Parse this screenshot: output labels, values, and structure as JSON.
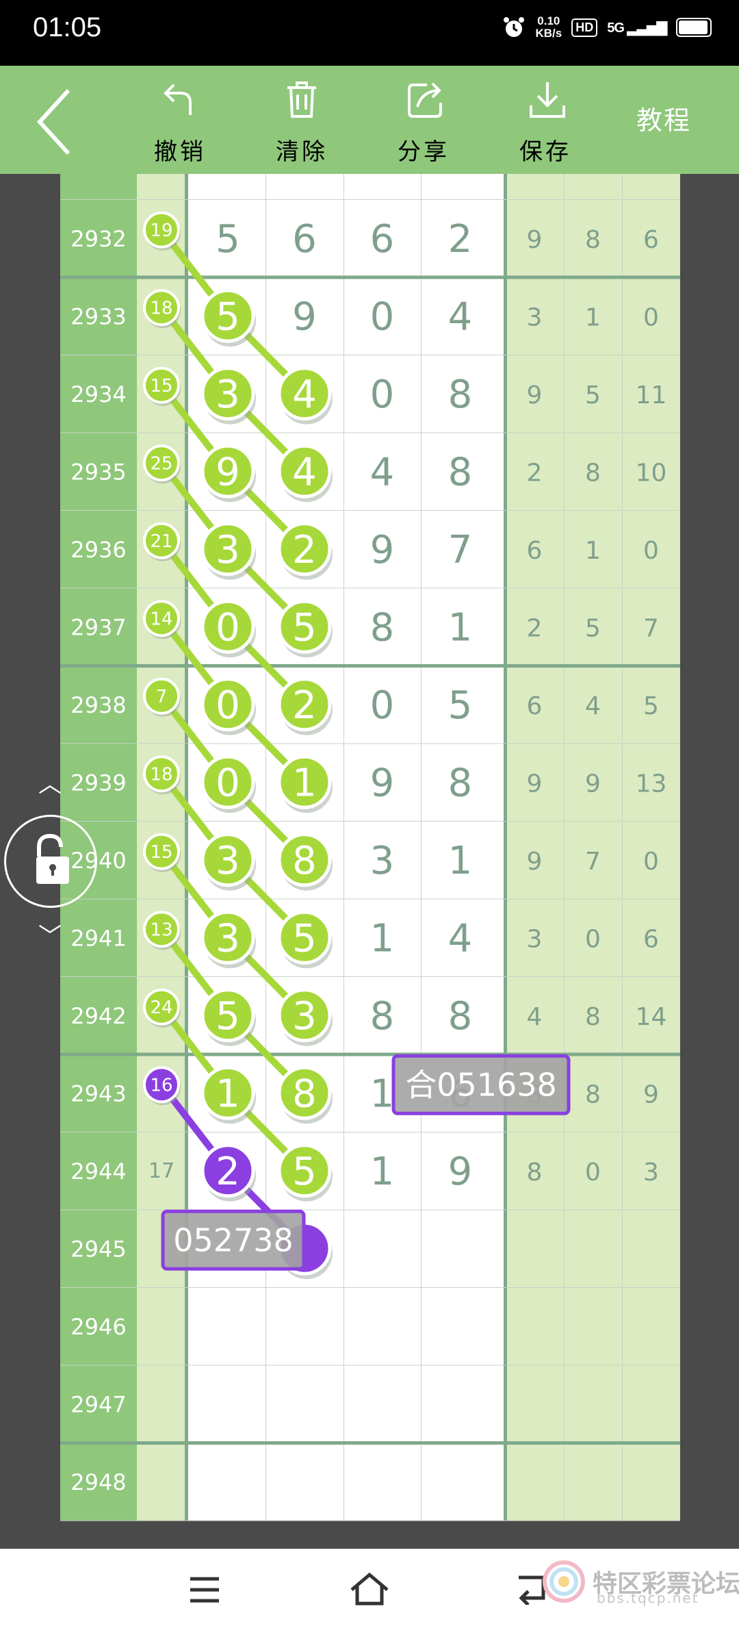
{
  "status": {
    "time": "01:05",
    "speed_value": "0.10",
    "speed_unit": "KB/s",
    "hd": "HD",
    "network": "5G"
  },
  "toolbar": {
    "undo": "撤销",
    "clear": "清除",
    "share": "分享",
    "save": "保存",
    "tutorial": "教程"
  },
  "watermark": {
    "name": "特区彩票论坛",
    "url": "bbs.tqcp.net"
  },
  "colors": {
    "toolbar": "#8fc77b",
    "highlight_green": "#a6d83a",
    "highlight_purple": "#8b3fe0",
    "digit_text": "#7f9f8c",
    "tag_bg": "#a3a3a3"
  },
  "chart_data": {
    "type": "table",
    "rows": [
      {
        "issue": "2932",
        "sum": "19",
        "digits": [
          "5",
          "6",
          "6",
          "2"
        ],
        "stats": [
          "9",
          "8",
          "6"
        ]
      },
      {
        "issue": "2933",
        "sum": "18",
        "digits": [
          "5",
          "9",
          "0",
          "4"
        ],
        "stats": [
          "3",
          "1",
          "0"
        ]
      },
      {
        "issue": "2934",
        "sum": "15",
        "digits": [
          "3",
          "4",
          "0",
          "8"
        ],
        "stats": [
          "9",
          "5",
          "11"
        ]
      },
      {
        "issue": "2935",
        "sum": "25",
        "digits": [
          "9",
          "4",
          "4",
          "8"
        ],
        "stats": [
          "2",
          "8",
          "10"
        ]
      },
      {
        "issue": "2936",
        "sum": "21",
        "digits": [
          "3",
          "2",
          "9",
          "7"
        ],
        "stats": [
          "6",
          "1",
          "0"
        ]
      },
      {
        "issue": "2937",
        "sum": "14",
        "digits": [
          "0",
          "5",
          "8",
          "1"
        ],
        "stats": [
          "2",
          "5",
          "7"
        ]
      },
      {
        "issue": "2938",
        "sum": "7",
        "digits": [
          "0",
          "2",
          "0",
          "5"
        ],
        "stats": [
          "6",
          "4",
          "5"
        ]
      },
      {
        "issue": "2939",
        "sum": "18",
        "digits": [
          "0",
          "1",
          "9",
          "8"
        ],
        "stats": [
          "9",
          "9",
          "13"
        ]
      },
      {
        "issue": "2940",
        "sum": "15",
        "digits": [
          "3",
          "8",
          "3",
          "1"
        ],
        "stats": [
          "9",
          "7",
          "0"
        ]
      },
      {
        "issue": "2941",
        "sum": "13",
        "digits": [
          "3",
          "5",
          "1",
          "4"
        ],
        "stats": [
          "3",
          "0",
          "6"
        ]
      },
      {
        "issue": "2942",
        "sum": "24",
        "digits": [
          "5",
          "3",
          "8",
          "8"
        ],
        "stats": [
          "4",
          "8",
          "14"
        ]
      },
      {
        "issue": "2943",
        "sum": "16",
        "digits": [
          "1",
          "8",
          "1",
          "6"
        ],
        "stats": [
          "8",
          "8",
          "9"
        ]
      },
      {
        "issue": "2944",
        "sum": "17",
        "digits": [
          "2",
          "5",
          "1",
          "9"
        ],
        "stats": [
          "8",
          "0",
          "3"
        ]
      },
      {
        "issue": "2945",
        "sum": "",
        "digits": [
          "",
          "",
          "",
          ""
        ],
        "stats": [
          "",
          "",
          ""
        ]
      },
      {
        "issue": "2946",
        "sum": "",
        "digits": [
          "",
          "",
          "",
          ""
        ],
        "stats": [
          "",
          "",
          ""
        ]
      },
      {
        "issue": "2947",
        "sum": "",
        "digits": [
          "",
          "",
          "",
          ""
        ],
        "stats": [
          "",
          "",
          ""
        ]
      },
      {
        "issue": "2948",
        "sum": "",
        "digits": [
          "",
          "",
          "",
          ""
        ],
        "stats": [
          "",
          "",
          ""
        ]
      }
    ],
    "highlights": {
      "sum_circles": [
        0,
        1,
        2,
        3,
        4,
        5,
        6,
        7,
        8,
        9,
        10,
        11
      ],
      "purple_sum_row": 11,
      "green_chains": [
        [
          [
            0,
            "s"
          ],
          [
            1,
            0
          ],
          [
            2,
            1
          ]
        ],
        [
          [
            1,
            "s"
          ],
          [
            2,
            0
          ],
          [
            3,
            1
          ]
        ],
        [
          [
            2,
            "s"
          ],
          [
            3,
            0
          ],
          [
            4,
            1
          ]
        ],
        [
          [
            3,
            "s"
          ],
          [
            4,
            0
          ],
          [
            5,
            1
          ]
        ],
        [
          [
            4,
            "s"
          ],
          [
            5,
            0
          ],
          [
            6,
            1
          ]
        ],
        [
          [
            5,
            "s"
          ],
          [
            6,
            0
          ],
          [
            7,
            1
          ]
        ],
        [
          [
            6,
            "s"
          ],
          [
            7,
            0
          ],
          [
            8,
            1
          ]
        ],
        [
          [
            7,
            "s"
          ],
          [
            8,
            0
          ],
          [
            9,
            1
          ]
        ],
        [
          [
            8,
            "s"
          ],
          [
            9,
            0
          ],
          [
            10,
            1
          ]
        ],
        [
          [
            9,
            "s"
          ],
          [
            10,
            0
          ],
          [
            11,
            1
          ]
        ],
        [
          [
            10,
            "s"
          ],
          [
            11,
            0
          ],
          [
            12,
            1
          ]
        ]
      ],
      "purple_chain": [
        [
          11,
          "s"
        ],
        [
          12,
          0
        ],
        [
          13,
          1
        ]
      ],
      "tags": [
        {
          "text": "合051638",
          "row": 11,
          "col": 3
        },
        {
          "text": "052738",
          "row": 13,
          "col": 0
        }
      ]
    }
  }
}
